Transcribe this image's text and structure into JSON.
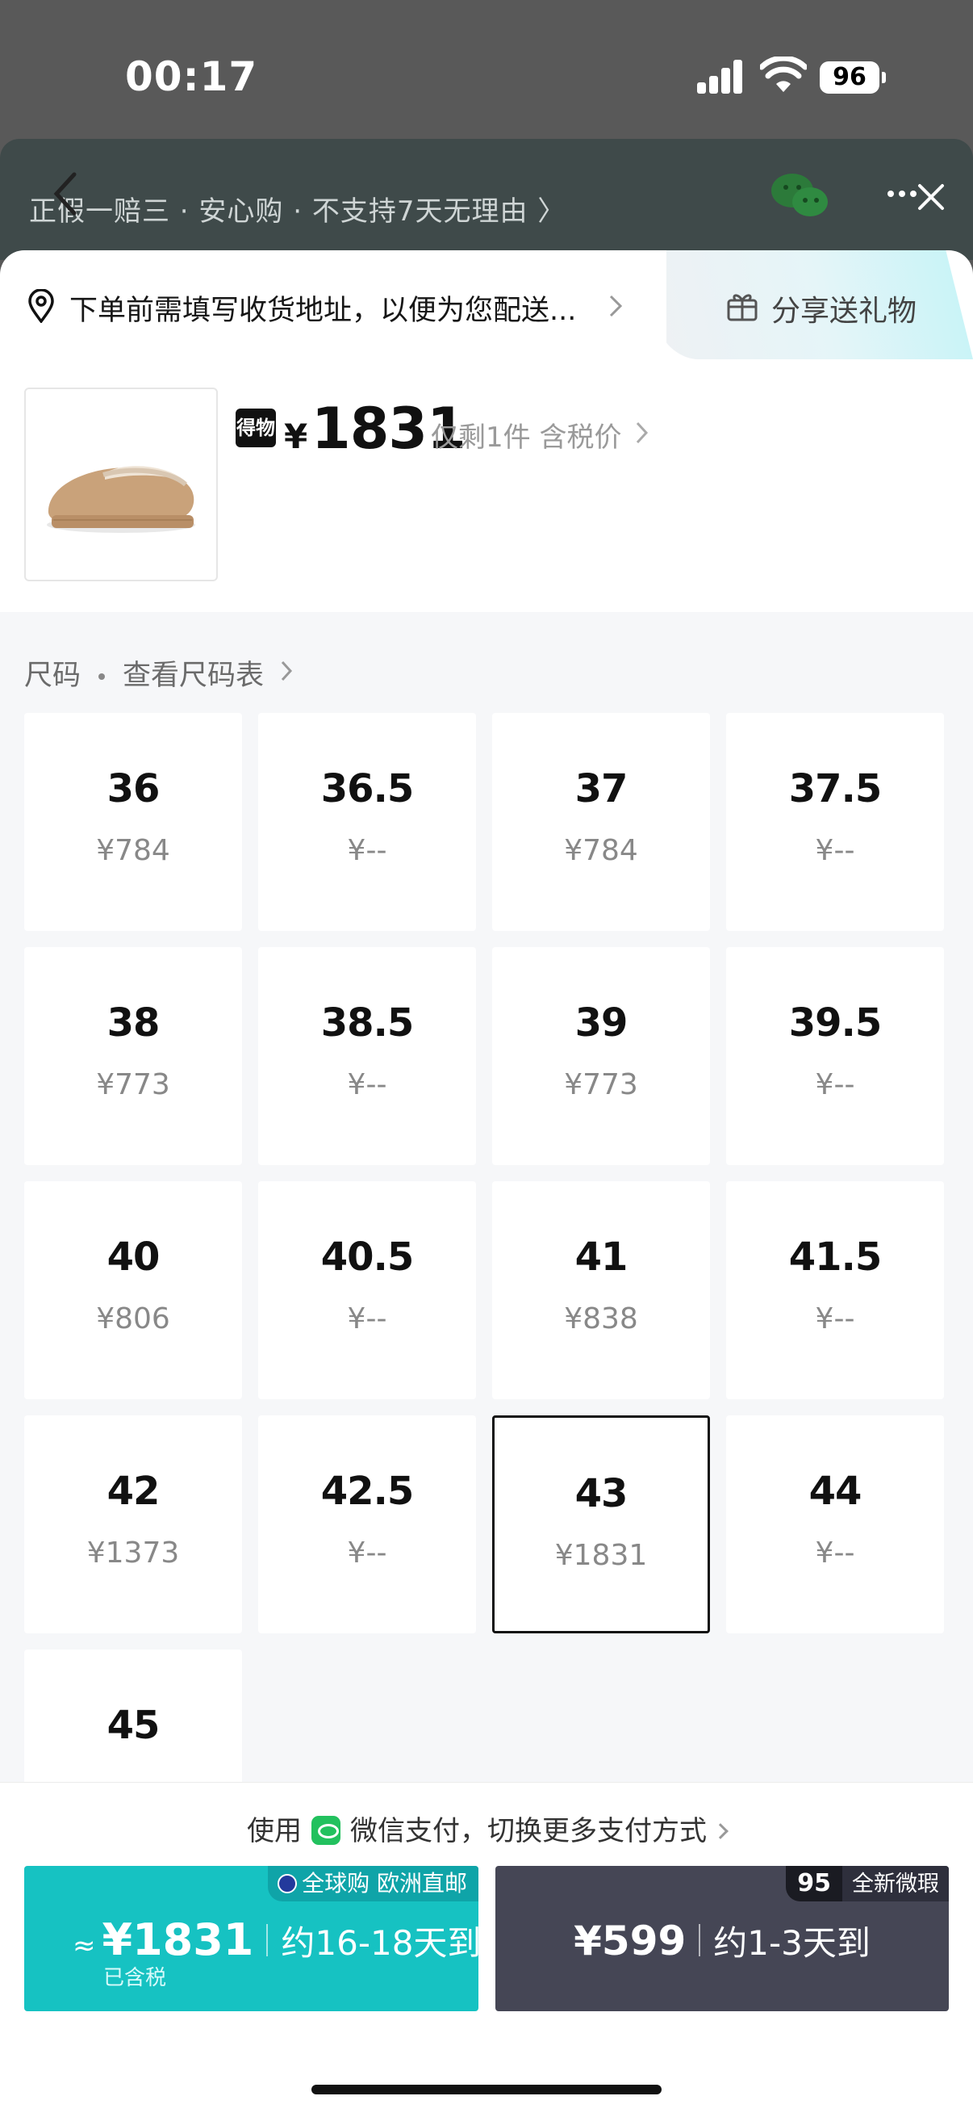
{
  "status_bar": {
    "time": "00:17",
    "battery": "96"
  },
  "header": {
    "guarantee": "正假一赔三 · 安心购 · 不支持7天无理由 〉"
  },
  "address": {
    "text": "下单前需填写收货地址，以便为您配送..."
  },
  "share": {
    "label": "分享送礼物"
  },
  "product": {
    "badge": "得物",
    "currency": "¥",
    "price": "1831",
    "stock_note": "仅剩1件  含税价"
  },
  "size_section": {
    "title": "尺码",
    "chart_link": "查看尺码表",
    "selected": "43",
    "sizes": [
      {
        "size": "36",
        "price": "¥784"
      },
      {
        "size": "36.5",
        "price": "¥--"
      },
      {
        "size": "37",
        "price": "¥784"
      },
      {
        "size": "37.5",
        "price": "¥--"
      },
      {
        "size": "38",
        "price": "¥773"
      },
      {
        "size": "38.5",
        "price": "¥--"
      },
      {
        "size": "39",
        "price": "¥773"
      },
      {
        "size": "39.5",
        "price": "¥--"
      },
      {
        "size": "40",
        "price": "¥806"
      },
      {
        "size": "40.5",
        "price": "¥--"
      },
      {
        "size": "41",
        "price": "¥838"
      },
      {
        "size": "41.5",
        "price": "¥--"
      },
      {
        "size": "42",
        "price": "¥1373"
      },
      {
        "size": "42.5",
        "price": "¥--"
      },
      {
        "size": "43",
        "price": "¥1831"
      },
      {
        "size": "44",
        "price": "¥--"
      },
      {
        "size": "45",
        "price": ""
      }
    ]
  },
  "payment": {
    "prefix": "使用",
    "method": "微信支付，切换更多支付方式"
  },
  "buy_global": {
    "tag": "全球购 欧洲直邮",
    "approx": "≈",
    "price": "¥1831",
    "eta": "约16-18天到",
    "tax_note": "已含税"
  },
  "buy_local": {
    "tag_grade": "95",
    "tag": "全新微瑕",
    "price": "¥599",
    "eta": "约1-3天到"
  },
  "colors": {
    "global_button": "#16c2c2",
    "local_button": "#454655",
    "selected_border": "#111111"
  }
}
